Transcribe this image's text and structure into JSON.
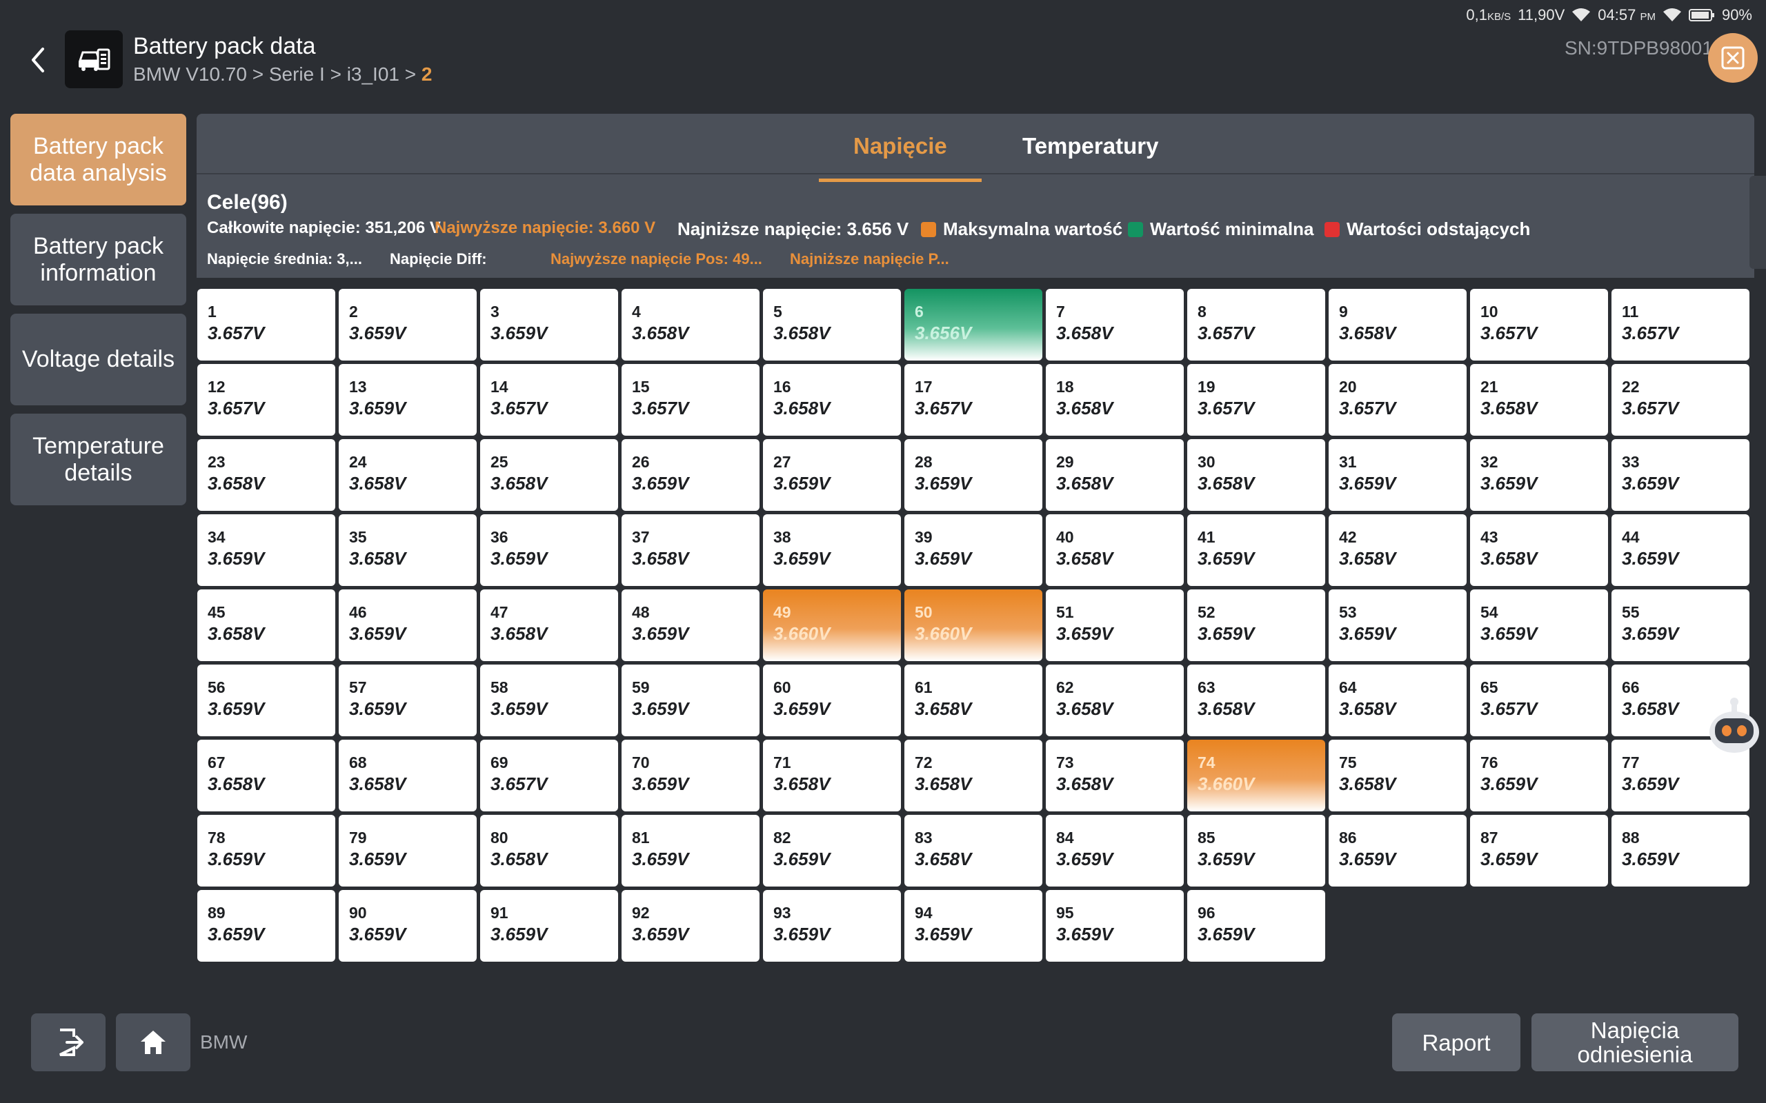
{
  "status_bar": {
    "net_speed": "0,1",
    "net_unit": "KB/S",
    "voltage": "11,90V",
    "time": "04:57",
    "ampm": "PM",
    "battery": "90%"
  },
  "header": {
    "title": "Battery pack data",
    "breadcrumb": "BMW V10.70 > Serie I > i3_I01 > ",
    "breadcrumb_last": "2",
    "serial": "SN:9TDPB98001"
  },
  "sidebar": {
    "items": [
      {
        "label": "Battery pack data analysis"
      },
      {
        "label": "Battery pack information"
      },
      {
        "label": "Voltage details"
      },
      {
        "label": "Temperature details"
      }
    ]
  },
  "tabs": [
    {
      "label": "Napięcie"
    },
    {
      "label": "Temperatury"
    }
  ],
  "summary": {
    "cells_title": "Cele(96)",
    "total": "Całkowite napięcie: 351,206 V",
    "highest": "Najwyższe napięcie: 3.660 V",
    "lowest": "Najniższe napięcie: 3.656 V",
    "avg": "Napięcie średnia: 3,...",
    "diff": "Napięcie Diff:",
    "highest_pos": "Najwyższe napięcie Pos: 49...",
    "lowest_pos": "Najniższe napięcie P..."
  },
  "legend": [
    {
      "label": "Maksymalna wartość",
      "color": "#e9862a"
    },
    {
      "label": "Wartość minimalna",
      "color": "#139461"
    },
    {
      "label": "Wartości odstających",
      "color": "#e23232"
    }
  ],
  "cells": [
    {
      "n": "1",
      "v": "3.657V"
    },
    {
      "n": "2",
      "v": "3.659V"
    },
    {
      "n": "3",
      "v": "3.659V"
    },
    {
      "n": "4",
      "v": "3.658V"
    },
    {
      "n": "5",
      "v": "3.658V"
    },
    {
      "n": "6",
      "v": "3.656V",
      "s": "min"
    },
    {
      "n": "7",
      "v": "3.658V"
    },
    {
      "n": "8",
      "v": "3.657V"
    },
    {
      "n": "9",
      "v": "3.658V"
    },
    {
      "n": "10",
      "v": "3.657V"
    },
    {
      "n": "11",
      "v": "3.657V"
    },
    {
      "n": "12",
      "v": "3.657V"
    },
    {
      "n": "13",
      "v": "3.659V"
    },
    {
      "n": "14",
      "v": "3.657V"
    },
    {
      "n": "15",
      "v": "3.657V"
    },
    {
      "n": "16",
      "v": "3.658V"
    },
    {
      "n": "17",
      "v": "3.657V"
    },
    {
      "n": "18",
      "v": "3.658V"
    },
    {
      "n": "19",
      "v": "3.657V"
    },
    {
      "n": "20",
      "v": "3.657V"
    },
    {
      "n": "21",
      "v": "3.658V"
    },
    {
      "n": "22",
      "v": "3.657V"
    },
    {
      "n": "23",
      "v": "3.658V"
    },
    {
      "n": "24",
      "v": "3.658V"
    },
    {
      "n": "25",
      "v": "3.658V"
    },
    {
      "n": "26",
      "v": "3.659V"
    },
    {
      "n": "27",
      "v": "3.659V"
    },
    {
      "n": "28",
      "v": "3.659V"
    },
    {
      "n": "29",
      "v": "3.658V"
    },
    {
      "n": "30",
      "v": "3.658V"
    },
    {
      "n": "31",
      "v": "3.659V"
    },
    {
      "n": "32",
      "v": "3.659V"
    },
    {
      "n": "33",
      "v": "3.659V"
    },
    {
      "n": "34",
      "v": "3.659V"
    },
    {
      "n": "35",
      "v": "3.658V"
    },
    {
      "n": "36",
      "v": "3.659V"
    },
    {
      "n": "37",
      "v": "3.658V"
    },
    {
      "n": "38",
      "v": "3.659V"
    },
    {
      "n": "39",
      "v": "3.659V"
    },
    {
      "n": "40",
      "v": "3.658V"
    },
    {
      "n": "41",
      "v": "3.659V"
    },
    {
      "n": "42",
      "v": "3.658V"
    },
    {
      "n": "43",
      "v": "3.658V"
    },
    {
      "n": "44",
      "v": "3.659V"
    },
    {
      "n": "45",
      "v": "3.658V"
    },
    {
      "n": "46",
      "v": "3.659V"
    },
    {
      "n": "47",
      "v": "3.658V"
    },
    {
      "n": "48",
      "v": "3.659V"
    },
    {
      "n": "49",
      "v": "3.660V",
      "s": "max"
    },
    {
      "n": "50",
      "v": "3.660V",
      "s": "max"
    },
    {
      "n": "51",
      "v": "3.659V"
    },
    {
      "n": "52",
      "v": "3.659V"
    },
    {
      "n": "53",
      "v": "3.659V"
    },
    {
      "n": "54",
      "v": "3.659V"
    },
    {
      "n": "55",
      "v": "3.659V"
    },
    {
      "n": "56",
      "v": "3.659V"
    },
    {
      "n": "57",
      "v": "3.659V"
    },
    {
      "n": "58",
      "v": "3.659V"
    },
    {
      "n": "59",
      "v": "3.659V"
    },
    {
      "n": "60",
      "v": "3.659V"
    },
    {
      "n": "61",
      "v": "3.658V"
    },
    {
      "n": "62",
      "v": "3.658V"
    },
    {
      "n": "63",
      "v": "3.658V"
    },
    {
      "n": "64",
      "v": "3.658V"
    },
    {
      "n": "65",
      "v": "3.657V"
    },
    {
      "n": "66",
      "v": "3.658V"
    },
    {
      "n": "67",
      "v": "3.658V"
    },
    {
      "n": "68",
      "v": "3.658V"
    },
    {
      "n": "69",
      "v": "3.657V"
    },
    {
      "n": "70",
      "v": "3.659V"
    },
    {
      "n": "71",
      "v": "3.658V"
    },
    {
      "n": "72",
      "v": "3.658V"
    },
    {
      "n": "73",
      "v": "3.658V"
    },
    {
      "n": "74",
      "v": "3.660V",
      "s": "max"
    },
    {
      "n": "75",
      "v": "3.658V"
    },
    {
      "n": "76",
      "v": "3.659V"
    },
    {
      "n": "77",
      "v": "3.659V"
    },
    {
      "n": "78",
      "v": "3.659V"
    },
    {
      "n": "79",
      "v": "3.659V"
    },
    {
      "n": "80",
      "v": "3.658V"
    },
    {
      "n": "81",
      "v": "3.659V"
    },
    {
      "n": "82",
      "v": "3.659V"
    },
    {
      "n": "83",
      "v": "3.658V"
    },
    {
      "n": "84",
      "v": "3.659V"
    },
    {
      "n": "85",
      "v": "3.659V"
    },
    {
      "n": "86",
      "v": "3.659V"
    },
    {
      "n": "87",
      "v": "3.659V"
    },
    {
      "n": "88",
      "v": "3.659V"
    },
    {
      "n": "89",
      "v": "3.659V"
    },
    {
      "n": "90",
      "v": "3.659V"
    },
    {
      "n": "91",
      "v": "3.659V"
    },
    {
      "n": "92",
      "v": "3.659V"
    },
    {
      "n": "93",
      "v": "3.659V"
    },
    {
      "n": "94",
      "v": "3.659V"
    },
    {
      "n": "95",
      "v": "3.659V"
    },
    {
      "n": "96",
      "v": "3.659V"
    }
  ],
  "bottom": {
    "brand": "BMW",
    "report_label": "Raport",
    "reference_label": "Napięcia odniesienia"
  },
  "icons": {
    "back": "chevron-left-icon",
    "app": "battery-pack-icon",
    "quick": "quick-access-icon",
    "exit": "exit-icon",
    "home": "home-icon",
    "assistant": "robot-assistant-icon"
  }
}
